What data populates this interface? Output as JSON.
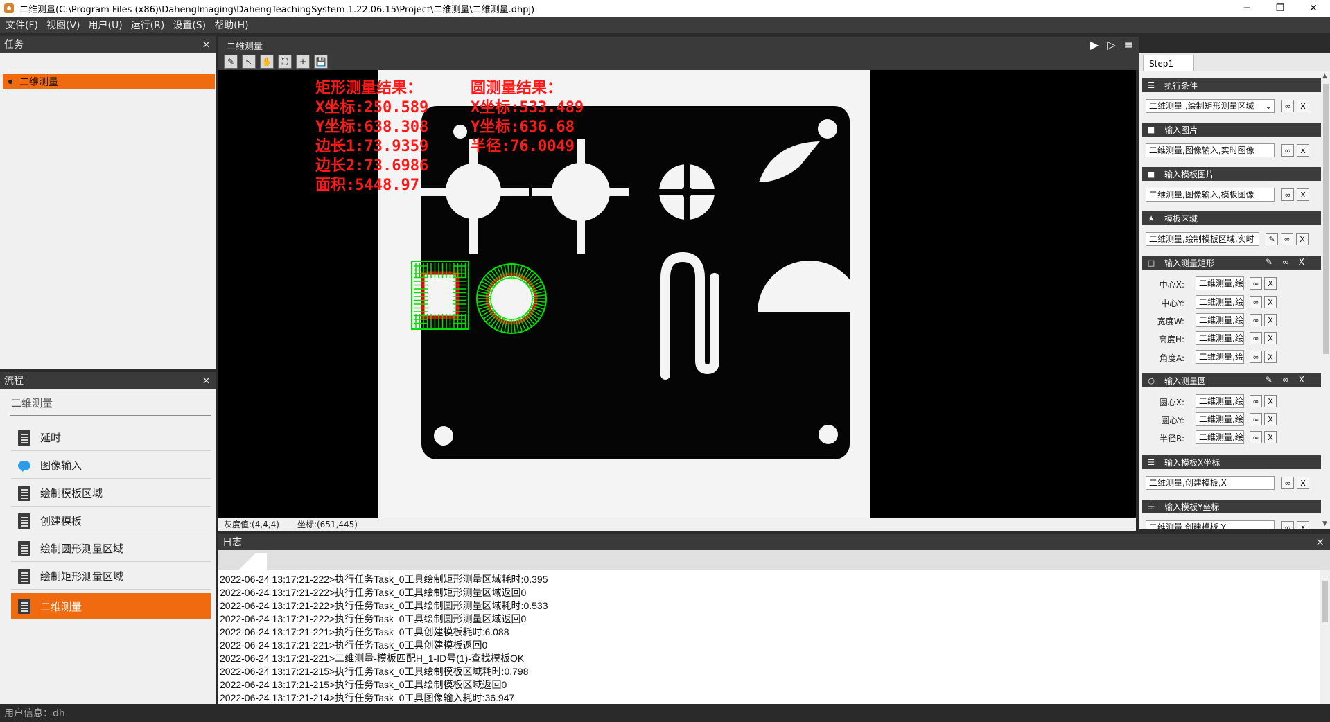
{
  "window": {
    "title": "二维测量(C:\\Program Files (x86)\\DahengImaging\\DahengTeachingSystem 1.22.06.15\\Project\\二维测量\\二维测量.dhpj)",
    "min": "─",
    "max": "❐",
    "close": "✕"
  },
  "menu": [
    "文件(F)",
    "视图(V)",
    "用户(U)",
    "运行(R)",
    "设置(S)",
    "帮助(H)"
  ],
  "task_panel": {
    "title": "任务",
    "close": "×",
    "items": [
      "二维测量"
    ]
  },
  "flow_panel": {
    "title": "流程",
    "close": "×",
    "group": "二维测量",
    "items": [
      {
        "label": "延时",
        "icon": "document-icon"
      },
      {
        "label": "图像输入",
        "icon": "chat-bubble-icon"
      },
      {
        "label": "绘制模板区域",
        "icon": "document-icon"
      },
      {
        "label": "创建模板",
        "icon": "document-icon"
      },
      {
        "label": "绘制圆形测量区域",
        "icon": "document-icon"
      },
      {
        "label": "绘制矩形测量区域",
        "icon": "document-icon"
      },
      {
        "label": "二维测量",
        "icon": "document-icon",
        "active": true
      }
    ]
  },
  "image_view": {
    "title": "二维测量",
    "run_icons": [
      "▶",
      "▷",
      "≡"
    ],
    "tools": [
      "✎",
      "↖",
      "✋",
      "⛶",
      "+",
      "💾"
    ],
    "rect_result": {
      "title": "矩形测量结果：",
      "lines": [
        "X坐标:250.589",
        "Y坐标:638.308",
        "边长1:73.9359",
        "边长2:73.6986",
        "面积:5448.97"
      ]
    },
    "circle_result": {
      "title": "圆测量结果：",
      "lines": [
        "X坐标:533.489",
        "Y坐标:636.68",
        "半径:76.0049"
      ]
    },
    "status_gray": "灰度值:(4,4,4)",
    "status_coord": "坐标:(651,445)"
  },
  "properties": {
    "tab": "Step1",
    "sections": [
      {
        "id": "exec",
        "title": "执行条件",
        "icon": "☰",
        "value": "二维测量 ,绘制矩形测量区域",
        "dropdown": true
      },
      {
        "id": "input_img",
        "title": "输入图片",
        "icon": "■",
        "value": "二维测量,图像输入,实时图像"
      },
      {
        "id": "tmpl_img",
        "title": "输入模板图片",
        "icon": "■",
        "value": "二维测量,图像输入,模板图像"
      },
      {
        "id": "tmpl_region",
        "title": "模板区域",
        "icon": "★",
        "value": "二维测量,绘制模板区域,实时"
      },
      {
        "id": "rect",
        "title": "输入测量矩形",
        "icon": "□",
        "fields": [
          {
            "label": "中心X:",
            "value": "二维测量,绘制"
          },
          {
            "label": "中心Y:",
            "value": "二维测量,绘制"
          },
          {
            "label": "宽度W:",
            "value": "二维测量,绘制"
          },
          {
            "label": "高度H:",
            "value": "二维测量,绘制"
          },
          {
            "label": "角度A:",
            "value": "二维测量,绘制"
          }
        ]
      },
      {
        "id": "circle",
        "title": "输入测量圆",
        "icon": "○",
        "fields": [
          {
            "label": "圆心X:",
            "value": "二维测量,绘制"
          },
          {
            "label": "圆心Y:",
            "value": "二维测量,绘制"
          },
          {
            "label": "半径R:",
            "value": "二维测量,绘制"
          }
        ]
      },
      {
        "id": "tmpl_x",
        "title": "输入模板X坐标",
        "icon": "☰",
        "value": "二维测量,创建模板,X"
      },
      {
        "id": "tmpl_y",
        "title": "输入模板Y坐标",
        "icon": "☰",
        "value": "二维测量,创建模板,Y"
      }
    ],
    "link_label": "∞",
    "clear_label": "X",
    "pen_label": "✎"
  },
  "log": {
    "title": "日志",
    "close": "×",
    "lines": [
      "2022-06-24 13:17:21-222>执行任务Task_0工具绘制矩形测量区域耗时:0.395",
      "2022-06-24 13:17:21-222>执行任务Task_0工具绘制矩形测量区域返回0",
      "2022-06-24 13:17:21-222>执行任务Task_0工具绘制圆形测量区域耗时:0.533",
      "2022-06-24 13:17:21-222>执行任务Task_0工具绘制圆形测量区域返回0",
      "2022-06-24 13:17:21-221>执行任务Task_0工具创建模板耗时:6.088",
      "2022-06-24 13:17:21-221>执行任务Task_0工具创建模板返回0",
      "2022-06-24 13:17:21-221>二维测量-模板匹配H_1-ID号(1)-查找模板OK",
      "2022-06-24 13:17:21-215>执行任务Task_0工具绘制模板区域耗时:0.798",
      "2022-06-24 13:17:21-215>执行任务Task_0工具绘制模板区域返回0",
      "2022-06-24 13:17:21-214>执行任务Task_0工具图像输入耗时:36.947"
    ]
  },
  "user_info": "用户信息：dh",
  "colors": {
    "accent": "#f06a0f",
    "overlay_text": "#ff1a1a",
    "green": "#00e000",
    "red": "#e00000"
  }
}
